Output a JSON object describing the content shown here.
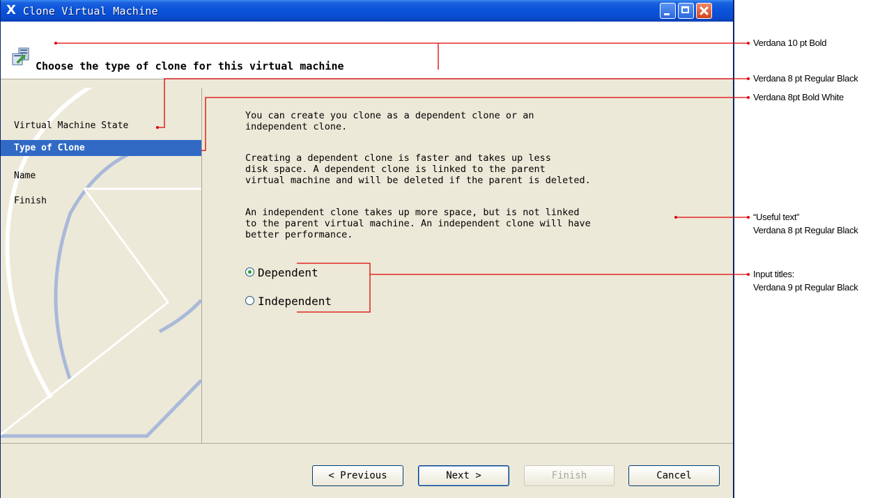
{
  "window": {
    "title_icon": "X",
    "title": "Clone Virtual Machine"
  },
  "header": {
    "title": "Choose the type of clone for this virtual machine",
    "icon": "clone-vm-icon"
  },
  "sidebar": {
    "items": [
      {
        "label": "Virtual Machine State",
        "selected": false
      },
      {
        "label": "Type of Clone",
        "selected": true
      },
      {
        "label": "Name",
        "selected": false
      },
      {
        "label": "Finish",
        "selected": false
      }
    ]
  },
  "main": {
    "paragraphs": [
      "You can create you clone as a dependent clone or an\nindependent clone.",
      "Creating a dependent clone is faster and takes up less\ndisk space. A dependent clone is linked to the parent\nvirtual machine and will be deleted if the parent is deleted.",
      "An independent clone takes up more space, but is not linked\nto the parent virtual machine. An independent clone will have\nbetter performance."
    ],
    "options": [
      {
        "label": "Dependent",
        "checked": true
      },
      {
        "label": "Independent",
        "checked": false
      }
    ]
  },
  "footer": {
    "previous": "< Previous",
    "next": "Next >",
    "finish": "Finish",
    "cancel": "Cancel"
  },
  "annotations": [
    "Verdana 10 pt Bold",
    "Verdana 8 pt  Regular Black",
    "Verdana 8pt Bold White",
    "“Useful text”",
    "Verdana 8 pt Regular Black",
    "Input titles:",
    "Verdana 9 pt Regular Black"
  ],
  "colors": {
    "titlebar": "#0a53d9",
    "selected_item": "#316ac5",
    "window_bg": "#ece9d8",
    "annotation_line": "#e00000",
    "radio_dot": "#21a121"
  }
}
